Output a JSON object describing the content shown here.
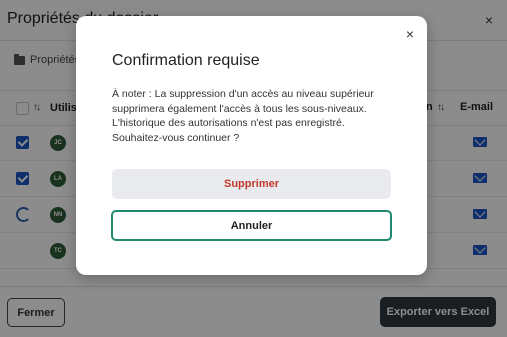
{
  "panel": {
    "title": "Propriétés du dossier",
    "close_glyph": "×",
    "breadcrumb": "Propriétés",
    "table": {
      "columns": [
        {
          "label": "Utilisateur"
        },
        {
          "label": "n"
        },
        {
          "label": "E-mail"
        }
      ],
      "sort_glyph": "↑↓",
      "rows": [
        {
          "initials": "JC",
          "state": "checked"
        },
        {
          "initials": "LA",
          "state": "checked"
        },
        {
          "initials": "NN",
          "state": "loading"
        },
        {
          "initials": "TC",
          "state": "none"
        }
      ]
    },
    "footer": {
      "close_label": "Fermer",
      "export_label": "Exporter vers Excel"
    }
  },
  "modal": {
    "title": "Confirmation requise",
    "close_glyph": "×",
    "body": "À noter : La suppression d'un accès au niveau supérieur supprimera également l'accès à tous les sous-niveaux. L'historique des autorisations n'est pas enregistré. Souhaitez-vous continuer ?",
    "delete_label": "Supprimer",
    "cancel_label": "Annuler"
  },
  "colors": {
    "accent": "#1a57c4",
    "danger": "#c0392b",
    "focus": "#1f8a70",
    "dark_button": "#2f3740",
    "avatar": "#2f5d3a"
  }
}
